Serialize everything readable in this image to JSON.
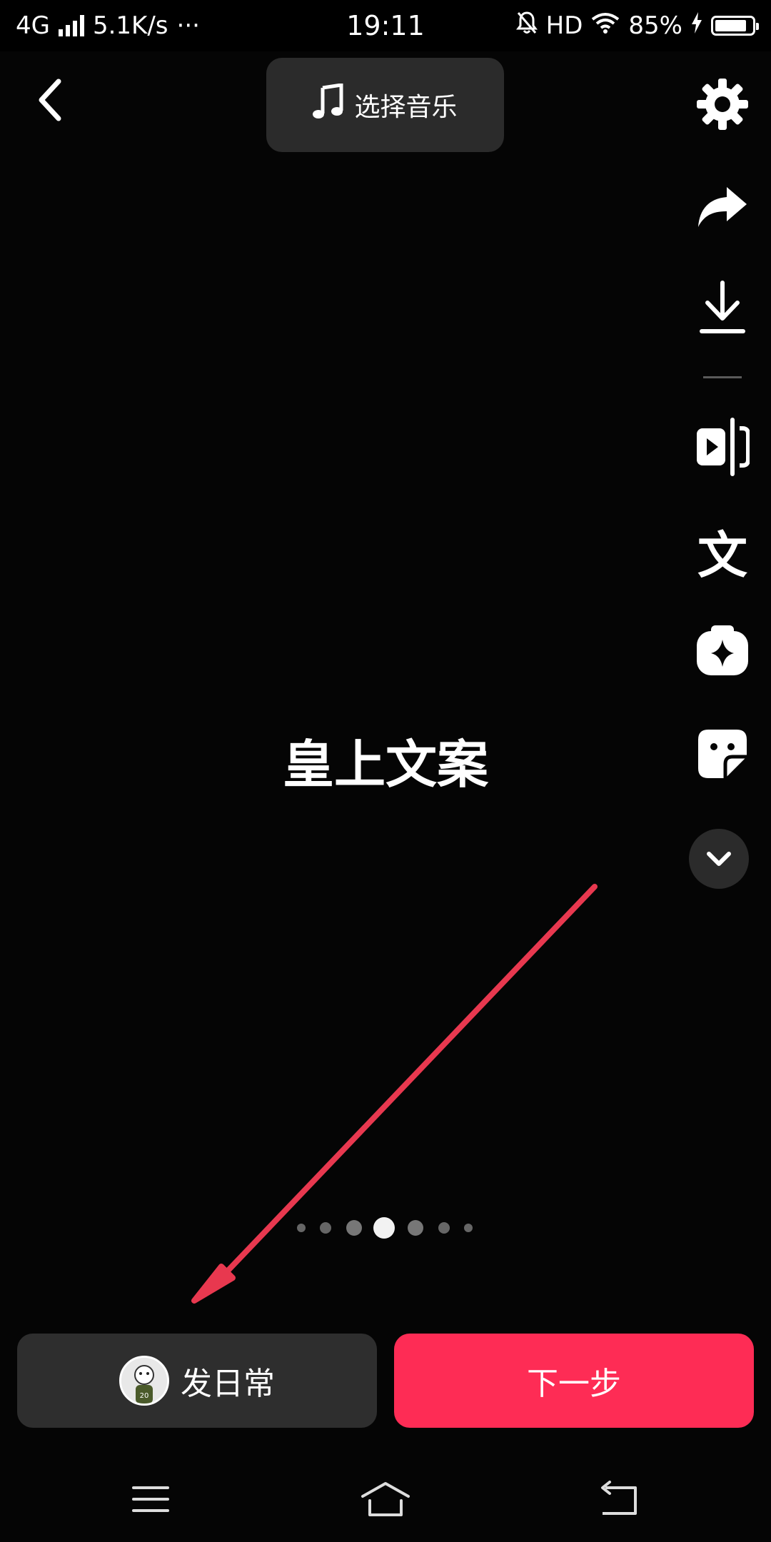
{
  "status_bar": {
    "network": "4G",
    "speed": "5.1K/s",
    "more": "···",
    "time": "19:11",
    "hd": "HD",
    "battery_percent": "85%",
    "battery_level": 0.85,
    "icons": [
      "signal-icon",
      "mute-bell-icon",
      "wifi-icon",
      "charging-icon",
      "battery-icon"
    ]
  },
  "header": {
    "music_label": "选择音乐",
    "icons": [
      "back-icon",
      "music-note-icon"
    ]
  },
  "right_rail": {
    "icons": [
      "settings-gear-icon",
      "share-arrow-icon",
      "download-icon",
      "video-split-icon",
      "text-wen-icon",
      "effects-sparkle-icon",
      "sticker-icon",
      "chevron-down-icon"
    ],
    "text_icon_glyph": "文"
  },
  "main": {
    "caption": "皇上文案"
  },
  "pagination": {
    "count": 7,
    "active_index": 3
  },
  "bottom": {
    "daily_label": "发日常",
    "next_label": "下一步"
  },
  "nav_bar": {
    "icons": [
      "menu-icon",
      "home-icon",
      "back-return-icon"
    ]
  },
  "colors": {
    "background": "#050505",
    "accent": "#fe2c55",
    "button_dark": "#2e2e2e",
    "annotation_arrow": "#e8384f"
  }
}
